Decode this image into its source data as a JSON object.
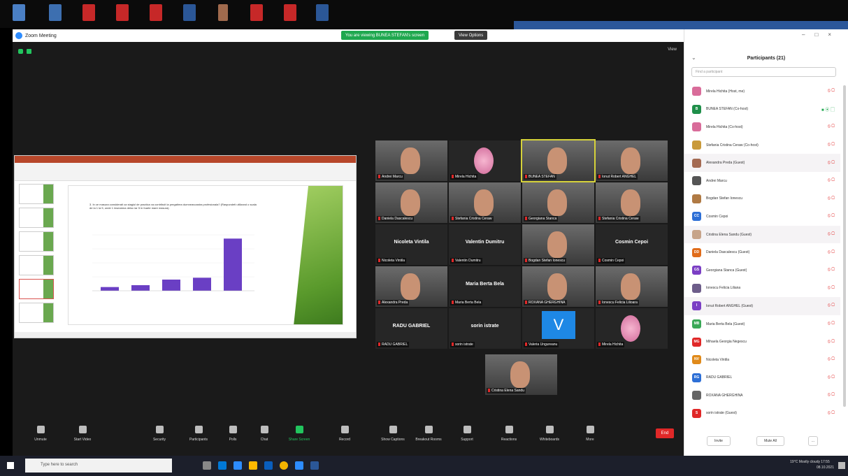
{
  "window": {
    "title": "Zoom Meeting",
    "share_banner": "You are viewing BUNEA STEFAN's screen",
    "view_options": "View Options",
    "view_label": "View"
  },
  "slide": {
    "text": "3. In ce masura considerati ca stagiul de practica va contribuit la pregatirea dumneavoastra profesionala? (Raspundeti utilizand o scala de la 1 la 5, unde 1 inseamna deloc iar 5 in foarte mare masura)",
    "chart": {
      "type": "bar",
      "values": [
        2,
        3,
        6,
        7,
        28
      ]
    }
  },
  "gallery": [
    {
      "name": "Andrei Marcu",
      "big": "",
      "kind": "video"
    },
    {
      "name": "Mirela Hichita",
      "big": "",
      "kind": "flower"
    },
    {
      "name": "BUNEA STEFAN",
      "big": "",
      "kind": "video",
      "speaker": true
    },
    {
      "name": "Ionut Robert ANGHEL",
      "big": "",
      "kind": "video"
    },
    {
      "name": "Daniela Dascalescu",
      "big": "",
      "kind": "video"
    },
    {
      "name": "Stefania Cristina Ceraw",
      "big": "",
      "kind": "video"
    },
    {
      "name": "Georgiana Stanca",
      "big": "",
      "kind": "video"
    },
    {
      "name": "Stefania Cristina Ceraw",
      "big": "",
      "kind": "video"
    },
    {
      "name": "Nicoleta Vintila",
      "big": "Nicoleta Vintila",
      "kind": "text"
    },
    {
      "name": "Valentin Dumitru",
      "big": "Valentin Dumitru",
      "kind": "text"
    },
    {
      "name": "Bogdan Stefan Ionescu",
      "big": "",
      "kind": "video"
    },
    {
      "name": "Cosmin Cepoi",
      "big": "Cosmin Cepoi",
      "kind": "text"
    },
    {
      "name": "Alexandra Preda",
      "big": "",
      "kind": "video"
    },
    {
      "name": "Maria Berta Bela",
      "big": "Maria Berta Bela",
      "kind": "text"
    },
    {
      "name": "ROXANA GHERGHINA",
      "big": "",
      "kind": "video"
    },
    {
      "name": "Ionescu Felicia Lilioara",
      "big": "",
      "kind": "video"
    },
    {
      "name": "RADU GABRIEL",
      "big": "RADU GABRIEL",
      "kind": "text"
    },
    {
      "name": "sorin istrate",
      "big": "sorin istrate",
      "kind": "text"
    },
    {
      "name": "Valeria Ungureanu",
      "big": "",
      "kind": "v"
    },
    {
      "name": "Mirela Hichita",
      "big": "",
      "kind": "flower"
    },
    {
      "name": "Cristina Elena Sandu",
      "big": "",
      "kind": "video"
    }
  ],
  "toolbar": [
    {
      "label": "Unmute",
      "green": false
    },
    {
      "label": "Start Video",
      "green": false
    },
    {
      "label": "Security",
      "green": false
    },
    {
      "label": "Participants",
      "green": false
    },
    {
      "label": "Polls",
      "green": false
    },
    {
      "label": "Chat",
      "green": false
    },
    {
      "label": "Share Screen",
      "green": true
    },
    {
      "label": "Record",
      "green": false
    },
    {
      "label": "Show Captions",
      "green": false
    },
    {
      "label": "Breakout Rooms",
      "green": false
    },
    {
      "label": "Support",
      "green": false
    },
    {
      "label": "Reactions",
      "green": false
    },
    {
      "label": "Whiteboards",
      "green": false
    },
    {
      "label": "More",
      "green": false
    }
  ],
  "end_label": "End",
  "panel": {
    "title": "Participants (21)",
    "search_placeholder": "Find a participant",
    "participants": [
      {
        "name": "Mirela Hichita (Host, me)",
        "initials": "",
        "color": "#d96c9a",
        "hl": false
      },
      {
        "name": "BUNEA STEFAN (Co-host)",
        "initials": "B",
        "color": "#1f8f4a",
        "hl": false,
        "video": true
      },
      {
        "name": "Mirela Hichita (Co-host)",
        "initials": "",
        "color": "#d96c9a",
        "hl": false
      },
      {
        "name": "Stefania Cristina Ceraw (Co-host)",
        "initials": "",
        "color": "#c99a3b",
        "hl": false
      },
      {
        "name": "Alexandra Preda (Guest)",
        "initials": "",
        "color": "#a46a52",
        "hl": true
      },
      {
        "name": "Andrei Marcu",
        "initials": "",
        "color": "#555",
        "hl": false
      },
      {
        "name": "Bogdan Stefan Ionescu",
        "initials": "",
        "color": "#b07a44",
        "hl": false
      },
      {
        "name": "Cosmin Cepoi",
        "initials": "CC",
        "color": "#2d6fd6",
        "hl": false
      },
      {
        "name": "Cristina Elena Sandu (Guest)",
        "initials": "",
        "color": "#c7a48a",
        "hl": true
      },
      {
        "name": "Daniela Dascalescu (Guest)",
        "initials": "DD",
        "color": "#e06c1a",
        "hl": false
      },
      {
        "name": "Georgiana Stanca (Guest)",
        "initials": "GS",
        "color": "#7b3fc4",
        "hl": false
      },
      {
        "name": "Ionescu Felicia Liliana",
        "initials": "",
        "color": "#6d5d8a",
        "hl": false
      },
      {
        "name": "Ionut Robert ANGHEL (Guest)",
        "initials": "I",
        "color": "#7b3fc4",
        "hl": true
      },
      {
        "name": "Maria Berta Bela (Guest)",
        "initials": "MB",
        "color": "#3aa857",
        "hl": false
      },
      {
        "name": "Mihaela Georgia Negescu",
        "initials": "MG",
        "color": "#e02828",
        "hl": false
      },
      {
        "name": "Nicoleta Vintila",
        "initials": "NV",
        "color": "#e08a1a",
        "hl": false
      },
      {
        "name": "RADU GABRIEL",
        "initials": "RG",
        "color": "#2d6fd6",
        "hl": false
      },
      {
        "name": "ROXANA GHERGHINA",
        "initials": "",
        "color": "#666",
        "hl": false
      },
      {
        "name": "sorin istrate (Guest)",
        "initials": "S",
        "color": "#e02828",
        "hl": false
      }
    ],
    "invite": "Invite",
    "mute_all": "Mute All",
    "more": "..."
  },
  "taskbar": {
    "search_placeholder": "Type here to search",
    "tray": "19°C Mostly cloudy",
    "lang": "ROU",
    "time": "17:55",
    "date": "08.10.2021"
  }
}
